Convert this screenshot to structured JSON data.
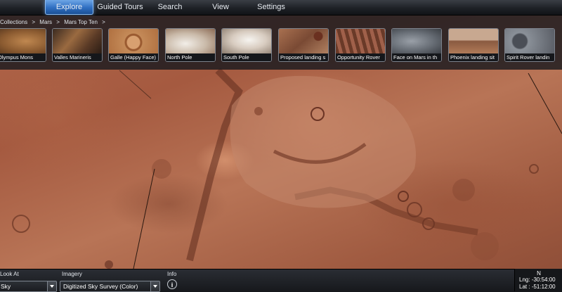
{
  "menu": {
    "items": [
      {
        "label": "Explore",
        "active": true
      },
      {
        "label": "Guided Tours"
      },
      {
        "label": "Search"
      },
      {
        "label": "View"
      },
      {
        "label": "Settings"
      }
    ]
  },
  "breadcrumb": [
    "Collections",
    ">",
    "Mars",
    ">",
    "Mars Top Ten",
    ">"
  ],
  "tours": [
    {
      "label": "Olympus Mons"
    },
    {
      "label": "Valles Marineris"
    },
    {
      "label": "Galle (Happy Face)"
    },
    {
      "label": "North Pole"
    },
    {
      "label": "South Pole"
    },
    {
      "label": "Proposed landing s"
    },
    {
      "label": "Opportunity Rover"
    },
    {
      "label": "Face on Mars in th"
    },
    {
      "label": "Phoenix landing sit"
    },
    {
      "label": "Spirit Rover landin"
    }
  ],
  "bottom": {
    "look_at_label": "Look At",
    "look_at_value": "Sky",
    "imagery_label": "Imagery",
    "imagery_value": "Digitized Sky Survey (Color)",
    "info_label": "Info",
    "info_icon": "i"
  },
  "coords": {
    "north": "N",
    "lng_label": "Lng:",
    "lng_value": "-30:54:00",
    "lat_label": "Lat :",
    "lat_value": "-51:12:00"
  }
}
